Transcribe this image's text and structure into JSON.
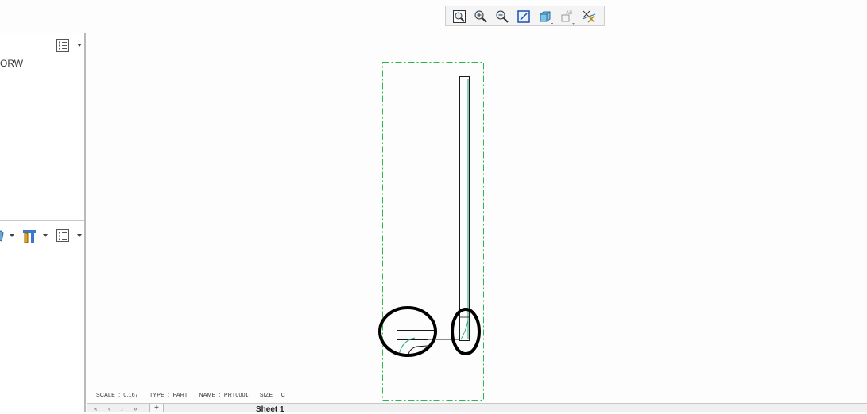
{
  "model_tree": {
    "root_item": "ORW"
  },
  "left_toolbar_icons": [
    "settings-list-icon",
    "appearance-icon",
    "tools-icon",
    "settings-list-icon"
  ],
  "view_toolbar": {
    "buttons": [
      "zoom-window-icon",
      "zoom-in-icon",
      "zoom-out-icon",
      "repaint-icon",
      "display-style-icon",
      "annotation-display-icon",
      "datum-display-icon"
    ]
  },
  "status": {
    "scale": "SCALE : 0.167",
    "type": "TYPE : PART",
    "name": "NAME : PRT0001",
    "size": "SIZE : C"
  },
  "sheets": {
    "first": "«",
    "prev": "‹",
    "next": "›",
    "last": "»",
    "add": "+",
    "tabs": [
      "Sheet 1"
    ]
  },
  "colors": {
    "geometry": "#1a1a1a",
    "tangent_edge": "#1aa37a",
    "view_boundary": "#2db84a",
    "markup": "#000000"
  }
}
